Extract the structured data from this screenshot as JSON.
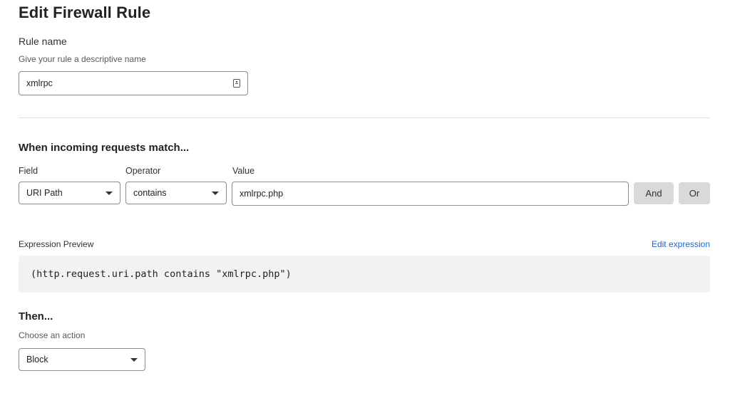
{
  "page": {
    "title": "Edit Firewall Rule"
  },
  "rule_name": {
    "label": "Rule name",
    "hint": "Give your rule a descriptive name",
    "value": "xmlrpc"
  },
  "match": {
    "section_title": "When incoming requests match...",
    "field_label": "Field",
    "operator_label": "Operator",
    "value_label": "Value",
    "field_value": "URI Path",
    "operator_value": "contains",
    "value_value": "xmlrpc.php",
    "and_label": "And",
    "or_label": "Or"
  },
  "expression": {
    "label": "Expression Preview",
    "edit_link": "Edit expression",
    "code": "(http.request.uri.path contains \"xmlrpc.php\")"
  },
  "then": {
    "section_title": "Then...",
    "hint": "Choose an action",
    "action_value": "Block"
  },
  "icons": {
    "rule_name_input_icon": "contact-card-icon",
    "dropdown_caret": "caret-down-icon"
  },
  "colors": {
    "link": "#1a66c9",
    "preview_bg": "#f2f2f2",
    "button_bg": "#d9d9d9"
  }
}
